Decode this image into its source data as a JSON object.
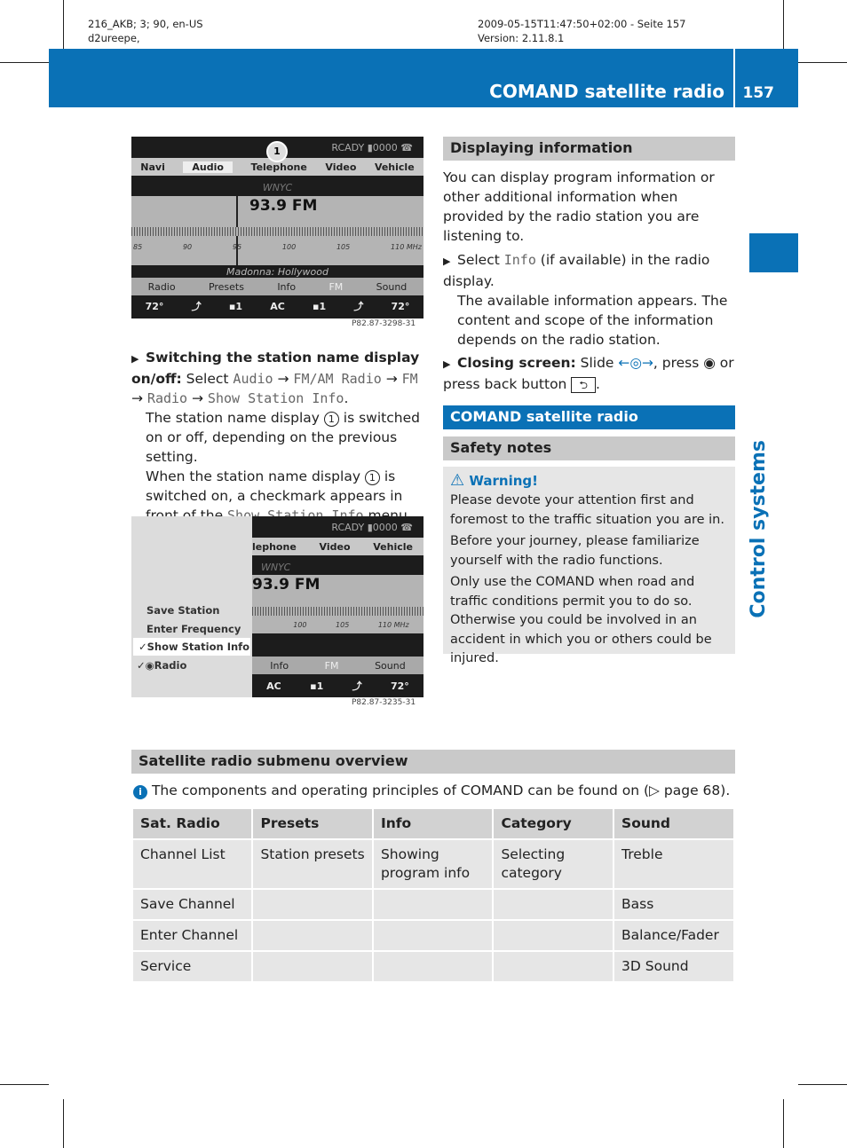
{
  "meta": {
    "left1": "216_AKB; 3; 90, en-US",
    "left2": "d2ureepe,",
    "right1": "2009-05-15T11:47:50+02:00 - Seite 157",
    "right2": "Version: 2.11.8.1"
  },
  "header": {
    "title": "COMAND satellite radio",
    "page": "157",
    "side_label": "Control systems",
    "accent": "#0a71b6"
  },
  "screen1": {
    "status": "RCADY ▮0000",
    "tabs": [
      "Navi",
      "Audio",
      "Telephone",
      "Video",
      "Vehicle"
    ],
    "station": "WNYC",
    "freq": "93.9 FM",
    "scale": [
      "85",
      "90",
      "95",
      "100",
      "105",
      "110 MHz"
    ],
    "track": "Madonna: Hollywood",
    "menu": [
      "Radio",
      "Presets",
      "Info",
      "FM",
      "Sound"
    ],
    "climate": [
      "72°",
      "AC",
      "72°"
    ],
    "callout": "1",
    "code": "P82.87-3298-31"
  },
  "screen2": {
    "status": "RCADY ▮0000",
    "tabs": [
      "lephone",
      "Video",
      "Vehicle"
    ],
    "station": "WNYC",
    "freq": "93.9 FM",
    "scale": [
      "100",
      "105",
      "110 MHz"
    ],
    "submenu": [
      "Save Station",
      "Enter Frequency",
      "Show Station Info",
      "Radio"
    ],
    "menu": [
      "Info",
      "FM",
      "Sound"
    ],
    "climate": [
      "AC",
      "72°"
    ],
    "code": "P82.87-3235-31"
  },
  "left": {
    "step_bold": "Switching the station name display on/off:",
    "select": " Select ",
    "m1": "Audio",
    "arrow": " → ",
    "m2": "FM/AM Radio",
    "m3": "FM",
    "m4": "Radio",
    "m5": "Show Station Info",
    "dot": ".",
    "p1a": "The station name display ",
    "callout": "1",
    "p1b": " is switched on or off, depending on the previous setting.",
    "p2a": "When the station name display ",
    "p2b": " is switched on, a checkmark appears in front of the ",
    "p2c": "Show Station Info",
    "p2d": " menu item."
  },
  "display": {
    "heading": "Displaying information",
    "intro": "You can display program information or other additional information when provided by the radio station you are listening to.",
    "s1a": "Select ",
    "s1m": "Info",
    "s1b": " (if available) in the radio display.",
    "s1c": "The available information appears. The content and scope of the information depends on the radio station.",
    "s2bold": "Closing screen:",
    "s2a": " Slide ",
    "slide": "←◎→",
    "s2b": ", press ",
    "press": "◉",
    "s2c": " or press back button ",
    "back": "⮌",
    "s2d": "."
  },
  "sat": {
    "heading": "COMAND satellite radio",
    "safety": "Safety notes",
    "warning_title": "Warning!",
    "w1": "Please devote your attention first and foremost to the traffic situation you are in.",
    "w2": "Before your journey, please familiarize yourself with the radio functions.",
    "w3": "Only use the COMAND when road and traffic conditions permit you to do so. Otherwise you could be involved in an accident in which you or others could be injured."
  },
  "overview": {
    "heading": "Satellite radio submenu overview",
    "info": "The components and operating principles of COMAND can be found on (▷ page 68).",
    "columns": [
      "Sat. Radio",
      "Presets",
      "Info",
      "Category",
      "Sound"
    ],
    "rows": [
      [
        "Channel List",
        "Station presets",
        "Showing program info",
        "Selecting category",
        "Treble"
      ],
      [
        "Save Channel",
        "",
        "",
        "",
        "Bass"
      ],
      [
        "Enter Channel",
        "",
        "",
        "",
        "Balance/Fader"
      ],
      [
        "Service",
        "",
        "",
        "",
        "3D Sound"
      ]
    ]
  }
}
